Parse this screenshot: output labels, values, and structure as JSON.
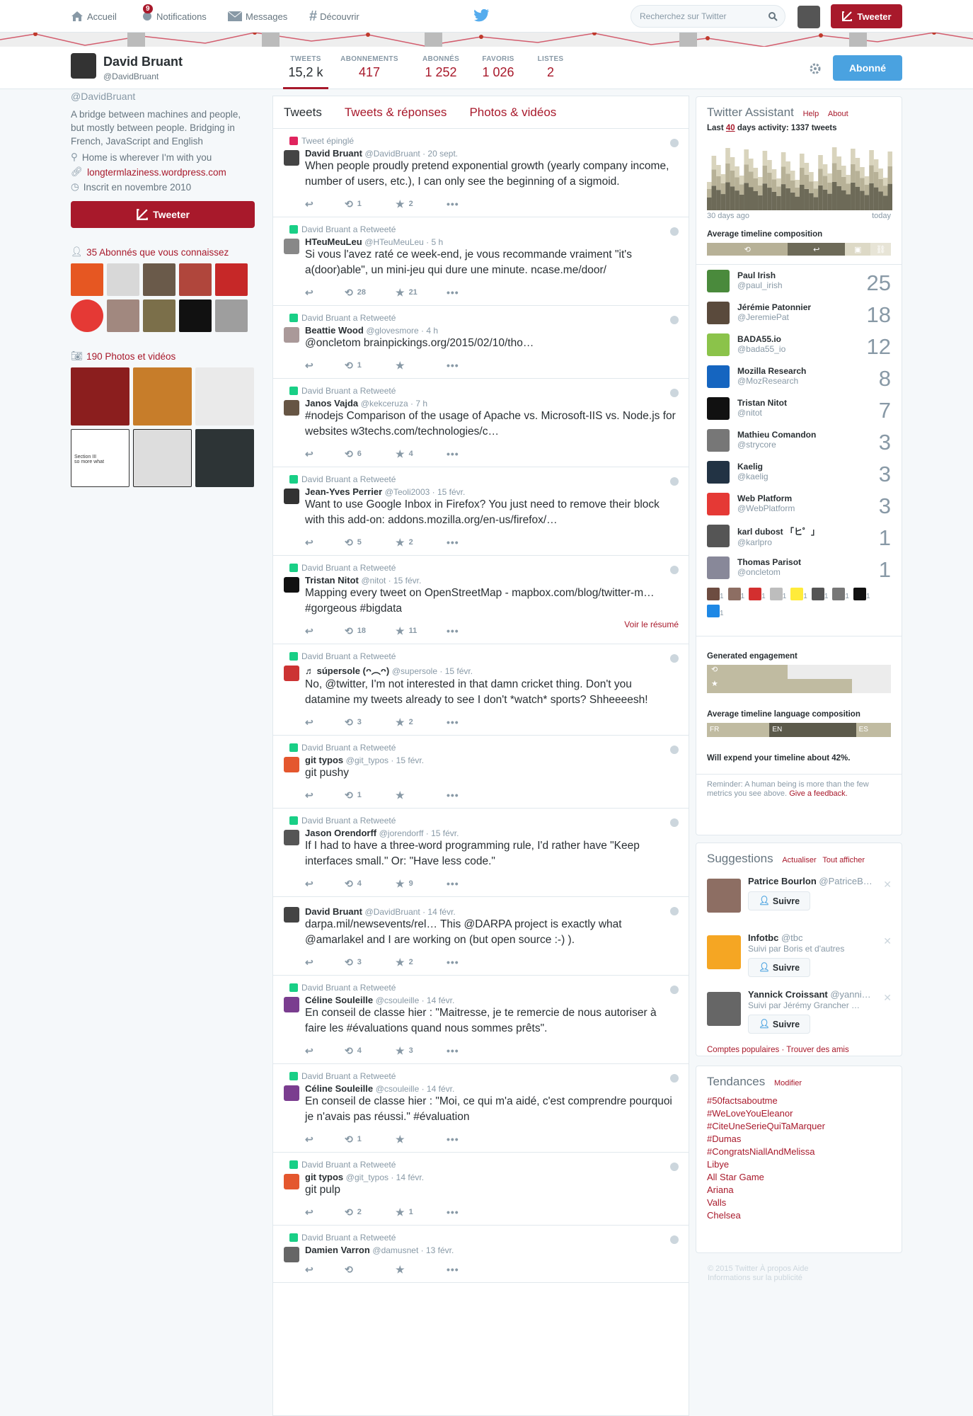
{
  "topbar": {
    "home": "Accueil",
    "notifications": "Notifications",
    "notif_count": "9",
    "messages": "Messages",
    "discover": "Découvrir",
    "search_placeholder": "Recherchez sur Twitter",
    "tweet_button": "Tweeter"
  },
  "profile": {
    "name": "David Bruant",
    "handle": "@DavidBruant",
    "bio": "A bridge between machines and people, but mostly between people. Bridging in French, JavaScript and English",
    "location": "Home is wherever I'm with you",
    "url": "longtermlaziness.wordpress.com",
    "joined": "Inscrit en novembre 2010",
    "tweet_button": "Tweeter",
    "followers_you_know": "35 Abonnés que vous connaissez",
    "photos_label": "190 Photos et vidéos",
    "photo_thumb_text": [
      "Section III",
      "so more what"
    ]
  },
  "stats": [
    {
      "label": "TWEETS",
      "value": "15,2 k"
    },
    {
      "label": "ABONNEMENTS",
      "value": "417"
    },
    {
      "label": "ABONNÉS",
      "value": "1 252"
    },
    {
      "label": "FAVORIS",
      "value": "1 026"
    },
    {
      "label": "LISTES",
      "value": "2"
    }
  ],
  "follow_button": "Abonné",
  "tabs": [
    "Tweets",
    "Tweets & réponses",
    "Photos & vidéos"
  ],
  "tweets": [
    {
      "ctx": "Tweet épinglé",
      "ctx_type": "pin",
      "name": "David Bruant",
      "handle": "@DavidBruant · 20 sept.",
      "text": "When people proudly pretend exponential growth (yearly company income, number of users, etc.), I can only see the beginning of a sigmoid.",
      "rt": "1",
      "fav": "2",
      "av": "#444",
      "summary": ""
    },
    {
      "ctx": "David Bruant a Retweeté",
      "ctx_type": "rt",
      "name": "HTeuMeuLeu",
      "handle": "@HTeuMeuLeu · 5 h",
      "text": "Si vous l'avez raté ce week-end, je vous recommande vraiment \"it's a(door)able\", un mini-jeu qui dure une minute. ncase.me/door/",
      "rt": "28",
      "fav": "21",
      "av": "#888",
      "summary": ""
    },
    {
      "ctx": "David Bruant a Retweeté",
      "ctx_type": "rt",
      "name": "Beattie Wood",
      "handle": "@glovesmore · 4 h",
      "text": "@oncletom brainpickings.org/2015/02/10/tho…",
      "rt": "1",
      "fav": "",
      "av": "#a99",
      "summary": ""
    },
    {
      "ctx": "David Bruant a Retweeté",
      "ctx_type": "rt",
      "name": "Janos Vajda",
      "handle": "@kekceruza · 7 h",
      "text": "#nodejs Comparison of the usage of Apache vs. Microsoft-IIS vs. Node.js for websites w3techs.com/technologies/c…",
      "rt": "6",
      "fav": "4",
      "av": "#654",
      "summary": ""
    },
    {
      "ctx": "David Bruant a Retweeté",
      "ctx_type": "rt",
      "name": "Jean-Yves Perrier",
      "handle": "@Teoli2003 · 15 févr.",
      "text": "Want to use Google Inbox in Firefox? You just need to remove their block with this add-on: addons.mozilla.org/en-us/firefox/…",
      "rt": "5",
      "fav": "2",
      "av": "#333",
      "summary": ""
    },
    {
      "ctx": "David Bruant a Retweeté",
      "ctx_type": "rt",
      "name": "Tristan Nitot",
      "handle": "@nitot · 15 févr.",
      "text": "Mapping every tweet on OpenStreetMap - mapbox.com/blog/twitter-m… #gorgeous #bigdata",
      "rt": "18",
      "fav": "11",
      "av": "#111",
      "summary": "Voir le résumé"
    },
    {
      "ctx": "David Bruant a Retweeté",
      "ctx_type": "rt",
      "name": "♬ súpersole (ᴖ︵ᴖ)",
      "handle": "@supersole · 15 févr.",
      "text": "No, @twitter, I'm not interested in that damn cricket thing. Don't you datamine my tweets already to see I don't *watch* sports? Shheeeesh!",
      "rt": "3",
      "fav": "2",
      "av": "#c33",
      "summary": ""
    },
    {
      "ctx": "David Bruant a Retweeté",
      "ctx_type": "rt",
      "name": "git typos",
      "handle": "@git_typos · 15 févr.",
      "text": "git pushy",
      "rt": "1",
      "fav": "",
      "av": "#e4572e",
      "summary": ""
    },
    {
      "ctx": "David Bruant a Retweeté",
      "ctx_type": "rt",
      "name": "Jason Orendorff",
      "handle": "@jorendorff · 15 févr.",
      "text": "If I had to have a three-word programming rule, I'd rather have \"Keep interfaces small.\" Or: \"Have less code.\"",
      "rt": "4",
      "fav": "9",
      "av": "#555",
      "summary": ""
    },
    {
      "ctx": "",
      "ctx_type": "",
      "name": "David Bruant",
      "handle": "@DavidBruant · 14 févr.",
      "text": "darpa.mil/newsevents/rel… This @DARPA project is exactly what @amarlakel and I are working on (but open source :-) ).",
      "rt": "3",
      "fav": "2",
      "av": "#444",
      "summary": ""
    },
    {
      "ctx": "David Bruant a Retweeté",
      "ctx_type": "rt",
      "name": "Céline Souleille",
      "handle": "@csouleille · 14 févr.",
      "text": "En conseil de classe hier : \"Maitresse, je te remercie de nous autoriser à faire les #évaluations quand nous sommes prêts\".",
      "rt": "4",
      "fav": "3",
      "av": "#7a3d8f",
      "summary": ""
    },
    {
      "ctx": "David Bruant a Retweeté",
      "ctx_type": "rt",
      "name": "Céline Souleille",
      "handle": "@csouleille · 14 févr.",
      "text": "En conseil de classe hier : \"Moi, ce qui m'a aidé, c'est comprendre pourquoi je n'avais pas réussi.\" #évaluation",
      "rt": "1",
      "fav": "",
      "av": "#7a3d8f",
      "summary": ""
    },
    {
      "ctx": "David Bruant a Retweeté",
      "ctx_type": "rt",
      "name": "git typos",
      "handle": "@git_typos · 14 févr.",
      "text": "git pulp",
      "rt": "2",
      "fav": "1",
      "av": "#e4572e",
      "summary": ""
    },
    {
      "ctx": "David Bruant a Retweeté",
      "ctx_type": "rt",
      "name": "Damien Varron",
      "handle": "@damusnet · 13 févr.",
      "text": "",
      "rt": "",
      "fav": "",
      "av": "#666",
      "summary": ""
    }
  ],
  "assistant": {
    "title": "Twitter Assistant",
    "help": "Help",
    "about": "About",
    "activity_prefix": "Last",
    "activity_days": "40",
    "activity_suffix": "days activity: 1337 tweets",
    "left_label": "30 days ago",
    "right_label": "today",
    "composition_title": "Average timeline composition",
    "engagement_title": "Generated engagement",
    "lang_title": "Average timeline language composition",
    "langs": [
      "FR",
      "EN",
      "ES"
    ],
    "expand": "Will expend your timeline about 42%.",
    "reminder": "Reminder: A human being is more than the few metrics you see above.",
    "feedback": "Give a feedback."
  },
  "assistant_users": [
    {
      "name": "Paul Irish",
      "handle": "@paul_irish",
      "count": "25",
      "av": "#4a8a3c"
    },
    {
      "name": "Jérémie Patonnier",
      "handle": "@JeremiePat",
      "count": "18",
      "av": "#5a4a3c"
    },
    {
      "name": "BADA55.io",
      "handle": "@bada55_io",
      "count": "12",
      "av": "#8bc34a"
    },
    {
      "name": "Mozilla Research",
      "handle": "@MozResearch",
      "count": "8",
      "av": "#1565c0"
    },
    {
      "name": "Tristan Nitot",
      "handle": "@nitot",
      "count": "7",
      "av": "#111"
    },
    {
      "name": "Mathieu Comandon",
      "handle": "@strycore",
      "count": "3",
      "av": "#777"
    },
    {
      "name": "Kaelig",
      "handle": "@kaelig",
      "count": "3",
      "av": "#234"
    },
    {
      "name": "Web Platform",
      "handle": "@WebPlatform",
      "count": "3",
      "av": "#e53935"
    },
    {
      "name": "karl dubost 「ヒ゜」",
      "handle": "@karlpro",
      "count": "1",
      "av": "#555"
    },
    {
      "name": "Thomas Parisot",
      "handle": "@oncletom",
      "count": "1",
      "av": "#889"
    }
  ],
  "small_counts": [
    "1",
    "1",
    "1",
    "1",
    "1",
    "1",
    "1",
    "1",
    "1"
  ],
  "suggestions": {
    "title": "Suggestions",
    "refresh": "Actualiser",
    "show_all": "Tout afficher",
    "follow": "Suivre",
    "items": [
      {
        "name": "Patrice Bourlon",
        "handle": "@PatriceB…",
        "sub": "",
        "av": "#8d6e63"
      },
      {
        "name": "Infotbc",
        "handle": "@tbc",
        "sub": "Suivi par Boris et d'autres",
        "av": "#f5a623"
      },
      {
        "name": "Yannick Croissant",
        "handle": "@yanni…",
        "sub": "Suivi par Jérémy Grancher …",
        "av": "#666"
      }
    ],
    "popular": "Comptes populaires",
    "find": "Trouver des amis"
  },
  "trends": {
    "title": "Tendances",
    "change": "Modifier",
    "items": [
      "#50factsaboutme",
      "#WeLoveYouEleanor",
      "#CiteUneSerieQuiTaMarquer",
      "#Dumas",
      "#CongratsNiallAndMelissa",
      "Libye",
      "All Star Game",
      "Ariana",
      "Valls",
      "Chelsea"
    ]
  },
  "footer": "© 2015 Twitter   À propos   Aide\nInformations sur la publicité",
  "colors": {
    "accent": "#a8192b",
    "follow_blue": "#4aa2e0"
  }
}
